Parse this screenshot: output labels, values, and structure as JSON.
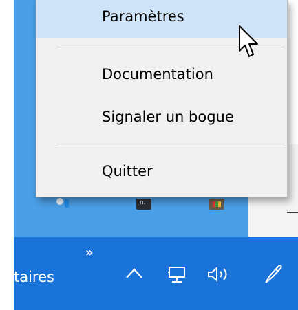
{
  "menu": {
    "items": [
      {
        "label": "Paramètres"
      },
      {
        "label": "Documentation"
      },
      {
        "label": "Signaler un bogue"
      },
      {
        "label": "Quitter"
      }
    ]
  },
  "taskbar": {
    "app_label_partial": "taires",
    "overflow_chevron": "»"
  },
  "desktop": {
    "icon2_text": "n."
  },
  "colors": {
    "taskbar": "#1a73d9",
    "desktop": "#4b9fe6",
    "menu_bg": "#f0f0f0",
    "menu_highlight": "#cfe4f9"
  },
  "icons": [
    "chevron-up-icon",
    "network-icon",
    "volume-icon",
    "pen-icon",
    "mouse-cursor-icon"
  ]
}
